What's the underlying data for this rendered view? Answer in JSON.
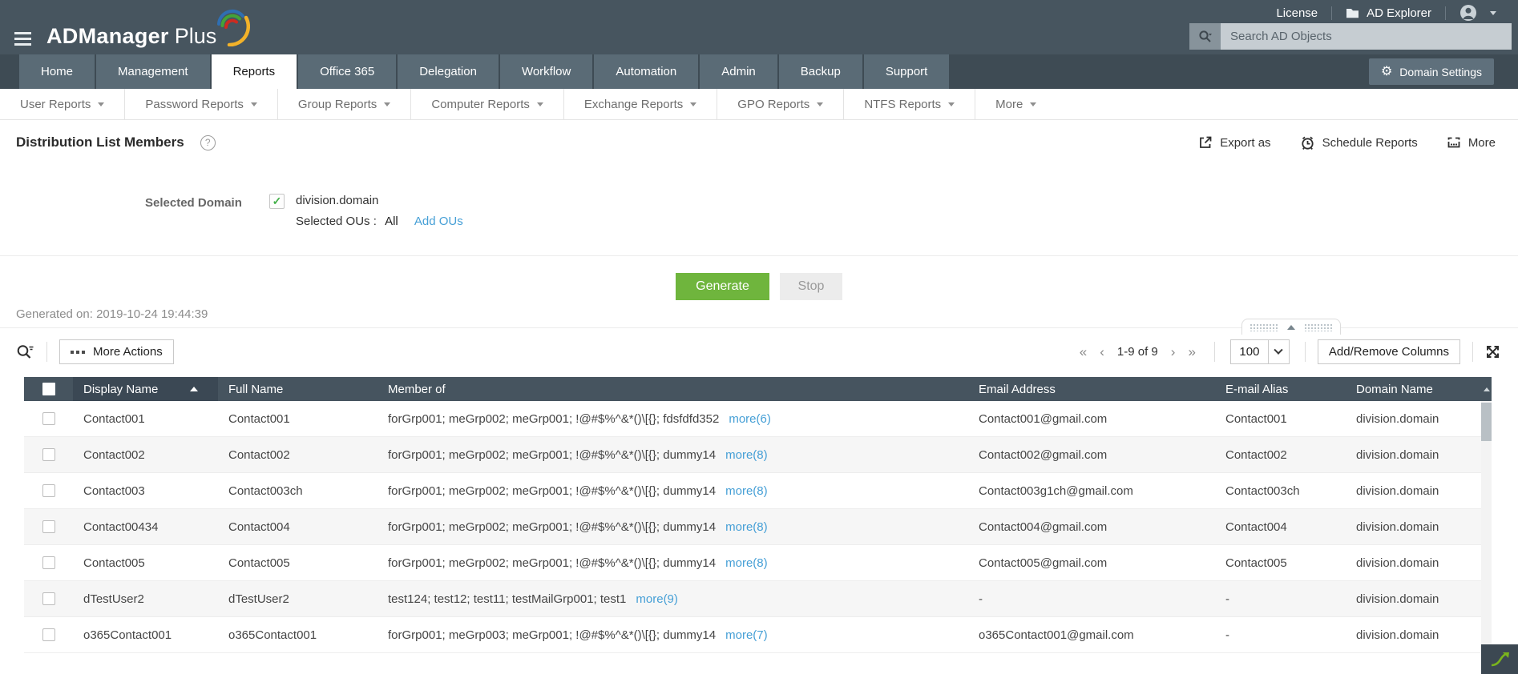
{
  "topbar": {
    "brand_bold": "ADManager",
    "brand_light": "Plus",
    "license_label": "License",
    "ad_explorer_label": "AD Explorer",
    "search_placeholder": "Search AD Objects"
  },
  "nav": {
    "tabs": [
      {
        "label": "Home",
        "active": false
      },
      {
        "label": "Management",
        "active": false
      },
      {
        "label": "Reports",
        "active": true
      },
      {
        "label": "Office 365",
        "active": false
      },
      {
        "label": "Delegation",
        "active": false
      },
      {
        "label": "Workflow",
        "active": false
      },
      {
        "label": "Automation",
        "active": false
      },
      {
        "label": "Admin",
        "active": false
      },
      {
        "label": "Backup",
        "active": false
      },
      {
        "label": "Support",
        "active": false
      }
    ],
    "domain_settings_label": "Domain Settings"
  },
  "subnav": {
    "items": [
      "User Reports",
      "Password Reports",
      "Group Reports",
      "Computer Reports",
      "Exchange Reports",
      "GPO Reports",
      "NTFS Reports",
      "More"
    ]
  },
  "page": {
    "title": "Distribution List Members",
    "help_glyph": "?",
    "actions": {
      "export_label": "Export as",
      "schedule_label": "Schedule Reports",
      "more_label": "More"
    }
  },
  "criteria": {
    "label": "Selected Domain",
    "checkbox_glyph": "✓",
    "domain": "division.domain",
    "selected_ous_label": "Selected OUs :",
    "selected_ous_value": "All",
    "add_ous_link": "Add OUs"
  },
  "generate": {
    "generate_label": "Generate",
    "stop_label": "Stop",
    "generated_on": "Generated on: 2019-10-24 19:44:39"
  },
  "toolbar": {
    "more_actions_label": "More Actions",
    "pagination": {
      "first": "«",
      "prev": "‹",
      "range": "1-9 of 9",
      "next": "›",
      "last": "»",
      "page_size": "100"
    },
    "add_remove_columns_label": "Add/Remove Columns"
  },
  "table": {
    "columns": {
      "display_name": "Display Name",
      "full_name": "Full Name",
      "member_of": "Member of",
      "email": "Email Address",
      "alias": "E-mail Alias",
      "domain": "Domain Name"
    },
    "rows": [
      {
        "display_name": "Contact001",
        "full_name": "Contact001",
        "member_of": "forGrp001; meGrp002; meGrp001; !@#$%^&*()\\[{}; fdsfdfd352",
        "more": "more(6)",
        "email": "Contact001@gmail.com",
        "alias": "Contact001",
        "domain": "division.domain"
      },
      {
        "display_name": "Contact002",
        "full_name": "Contact002",
        "member_of": "forGrp001; meGrp002; meGrp001; !@#$%^&*()\\[{}; dummy14",
        "more": "more(8)",
        "email": "Contact002@gmail.com",
        "alias": "Contact002",
        "domain": "division.domain"
      },
      {
        "display_name": "Contact003",
        "full_name": "Contact003ch",
        "member_of": "forGrp001; meGrp002; meGrp001; !@#$%^&*()\\[{}; dummy14",
        "more": "more(8)",
        "email": "Contact003g1ch@gmail.com",
        "alias": "Contact003ch",
        "domain": "division.domain"
      },
      {
        "display_name": "Contact00434",
        "full_name": "Contact004",
        "member_of": "forGrp001; meGrp002; meGrp001; !@#$%^&*()\\[{}; dummy14",
        "more": "more(8)",
        "email": "Contact004@gmail.com",
        "alias": "Contact004",
        "domain": "division.domain"
      },
      {
        "display_name": "Contact005",
        "full_name": "Contact005",
        "member_of": "forGrp001; meGrp002; meGrp001; !@#$%^&*()\\[{}; dummy14",
        "more": "more(8)",
        "email": "Contact005@gmail.com",
        "alias": "Contact005",
        "domain": "division.domain"
      },
      {
        "display_name": "dTestUser2",
        "full_name": "dTestUser2",
        "member_of": "test124; test12; test11; testMailGrp001; test1",
        "more": "more(9)",
        "email": "-",
        "alias": "-",
        "domain": "division.domain"
      },
      {
        "display_name": "o365Contact001",
        "full_name": "o365Contact001",
        "member_of": "forGrp001; meGrp003; meGrp001; !@#$%^&*()\\[{}; dummy14",
        "more": "more(7)",
        "email": "o365Contact001@gmail.com",
        "alias": "-",
        "domain": "division.domain"
      }
    ]
  },
  "colors": {
    "header_bg": "#47555f",
    "tab_bg": "#5a6b76",
    "table_header_bg": "#46545f",
    "accent_green": "#6fb53d",
    "link_blue": "#459fd6",
    "logo_yellow": "#f3b229",
    "logo_blue": "#2f6fb2",
    "logo_green": "#44a338",
    "logo_red": "#cd2b20"
  }
}
